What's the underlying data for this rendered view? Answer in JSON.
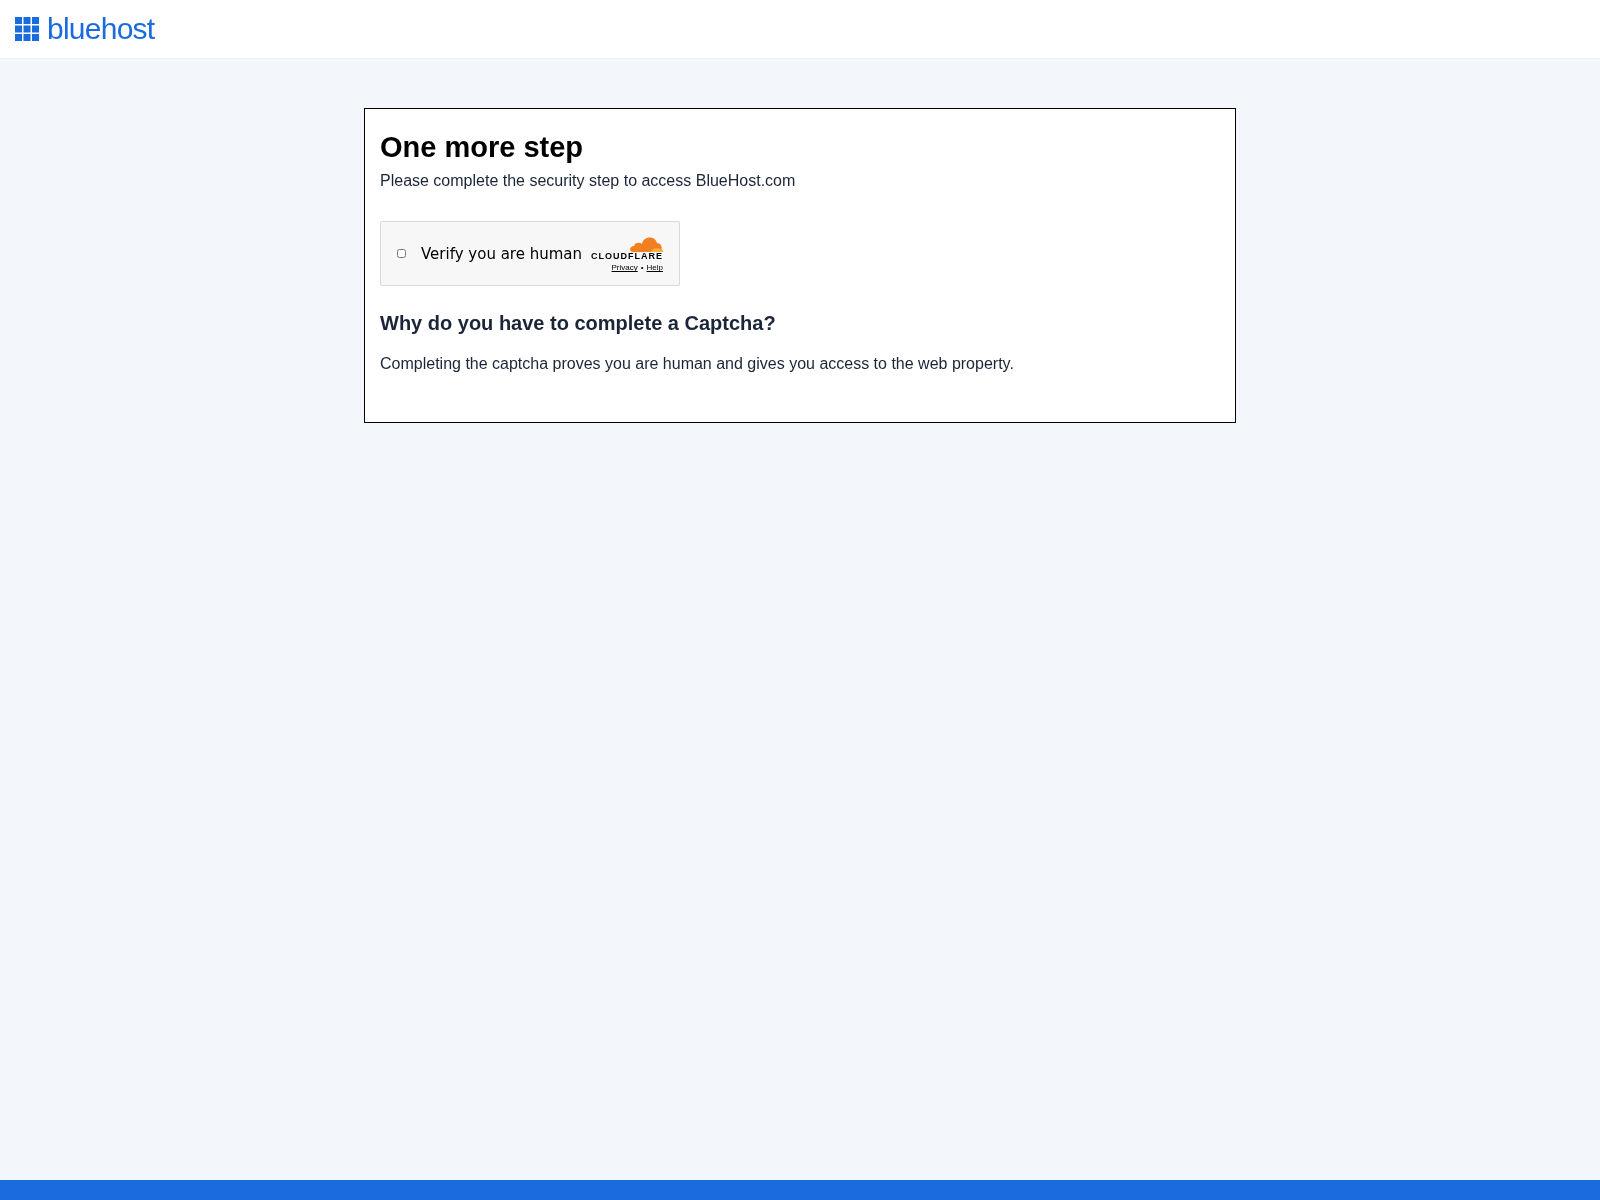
{
  "header": {
    "logo_text": "bluehost"
  },
  "card": {
    "title": "One more step",
    "subtitle": "Please complete the security step to access BlueHost.com",
    "widget": {
      "checked": false,
      "label": "Verify you are human",
      "brand": "CLOUDFLARE",
      "links": [
        "Privacy",
        "Help"
      ],
      "separator": "•"
    },
    "heading": "Why do you have to complete a Captcha?",
    "body": "Completing the captcha proves you are human and gives you access to the web property."
  }
}
